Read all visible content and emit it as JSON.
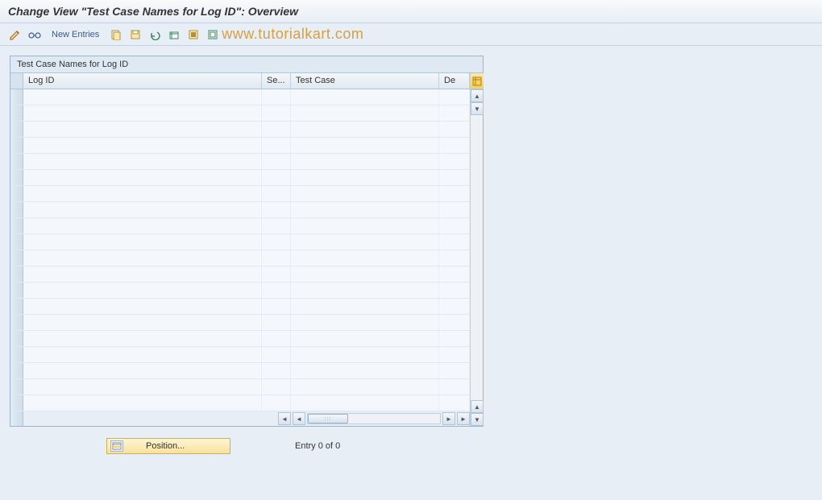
{
  "header": {
    "title": "Change View \"Test Case Names for Log ID\": Overview"
  },
  "toolbar": {
    "new_entries_label": "New Entries"
  },
  "icons": {
    "edit": "edit-icon",
    "glasses": "glasses-icon",
    "copy": "copy-icon",
    "save": "save-icon",
    "undo": "undo-icon",
    "select_all": "select-all-icon",
    "deselect": "deselect-icon",
    "delete": "delete-icon"
  },
  "watermark": "www.tutorialkart.com",
  "table": {
    "title": "Test Case Names for Log ID",
    "columns": {
      "log_id": "Log ID",
      "se": "Se...",
      "test_case": "Test Case",
      "de": "De"
    },
    "rows": [
      {},
      {},
      {},
      {},
      {},
      {},
      {},
      {},
      {},
      {},
      {},
      {},
      {},
      {},
      {},
      {},
      {},
      {},
      {},
      {}
    ]
  },
  "footer": {
    "position_label": "Position...",
    "entry_status": "Entry 0 of 0"
  }
}
